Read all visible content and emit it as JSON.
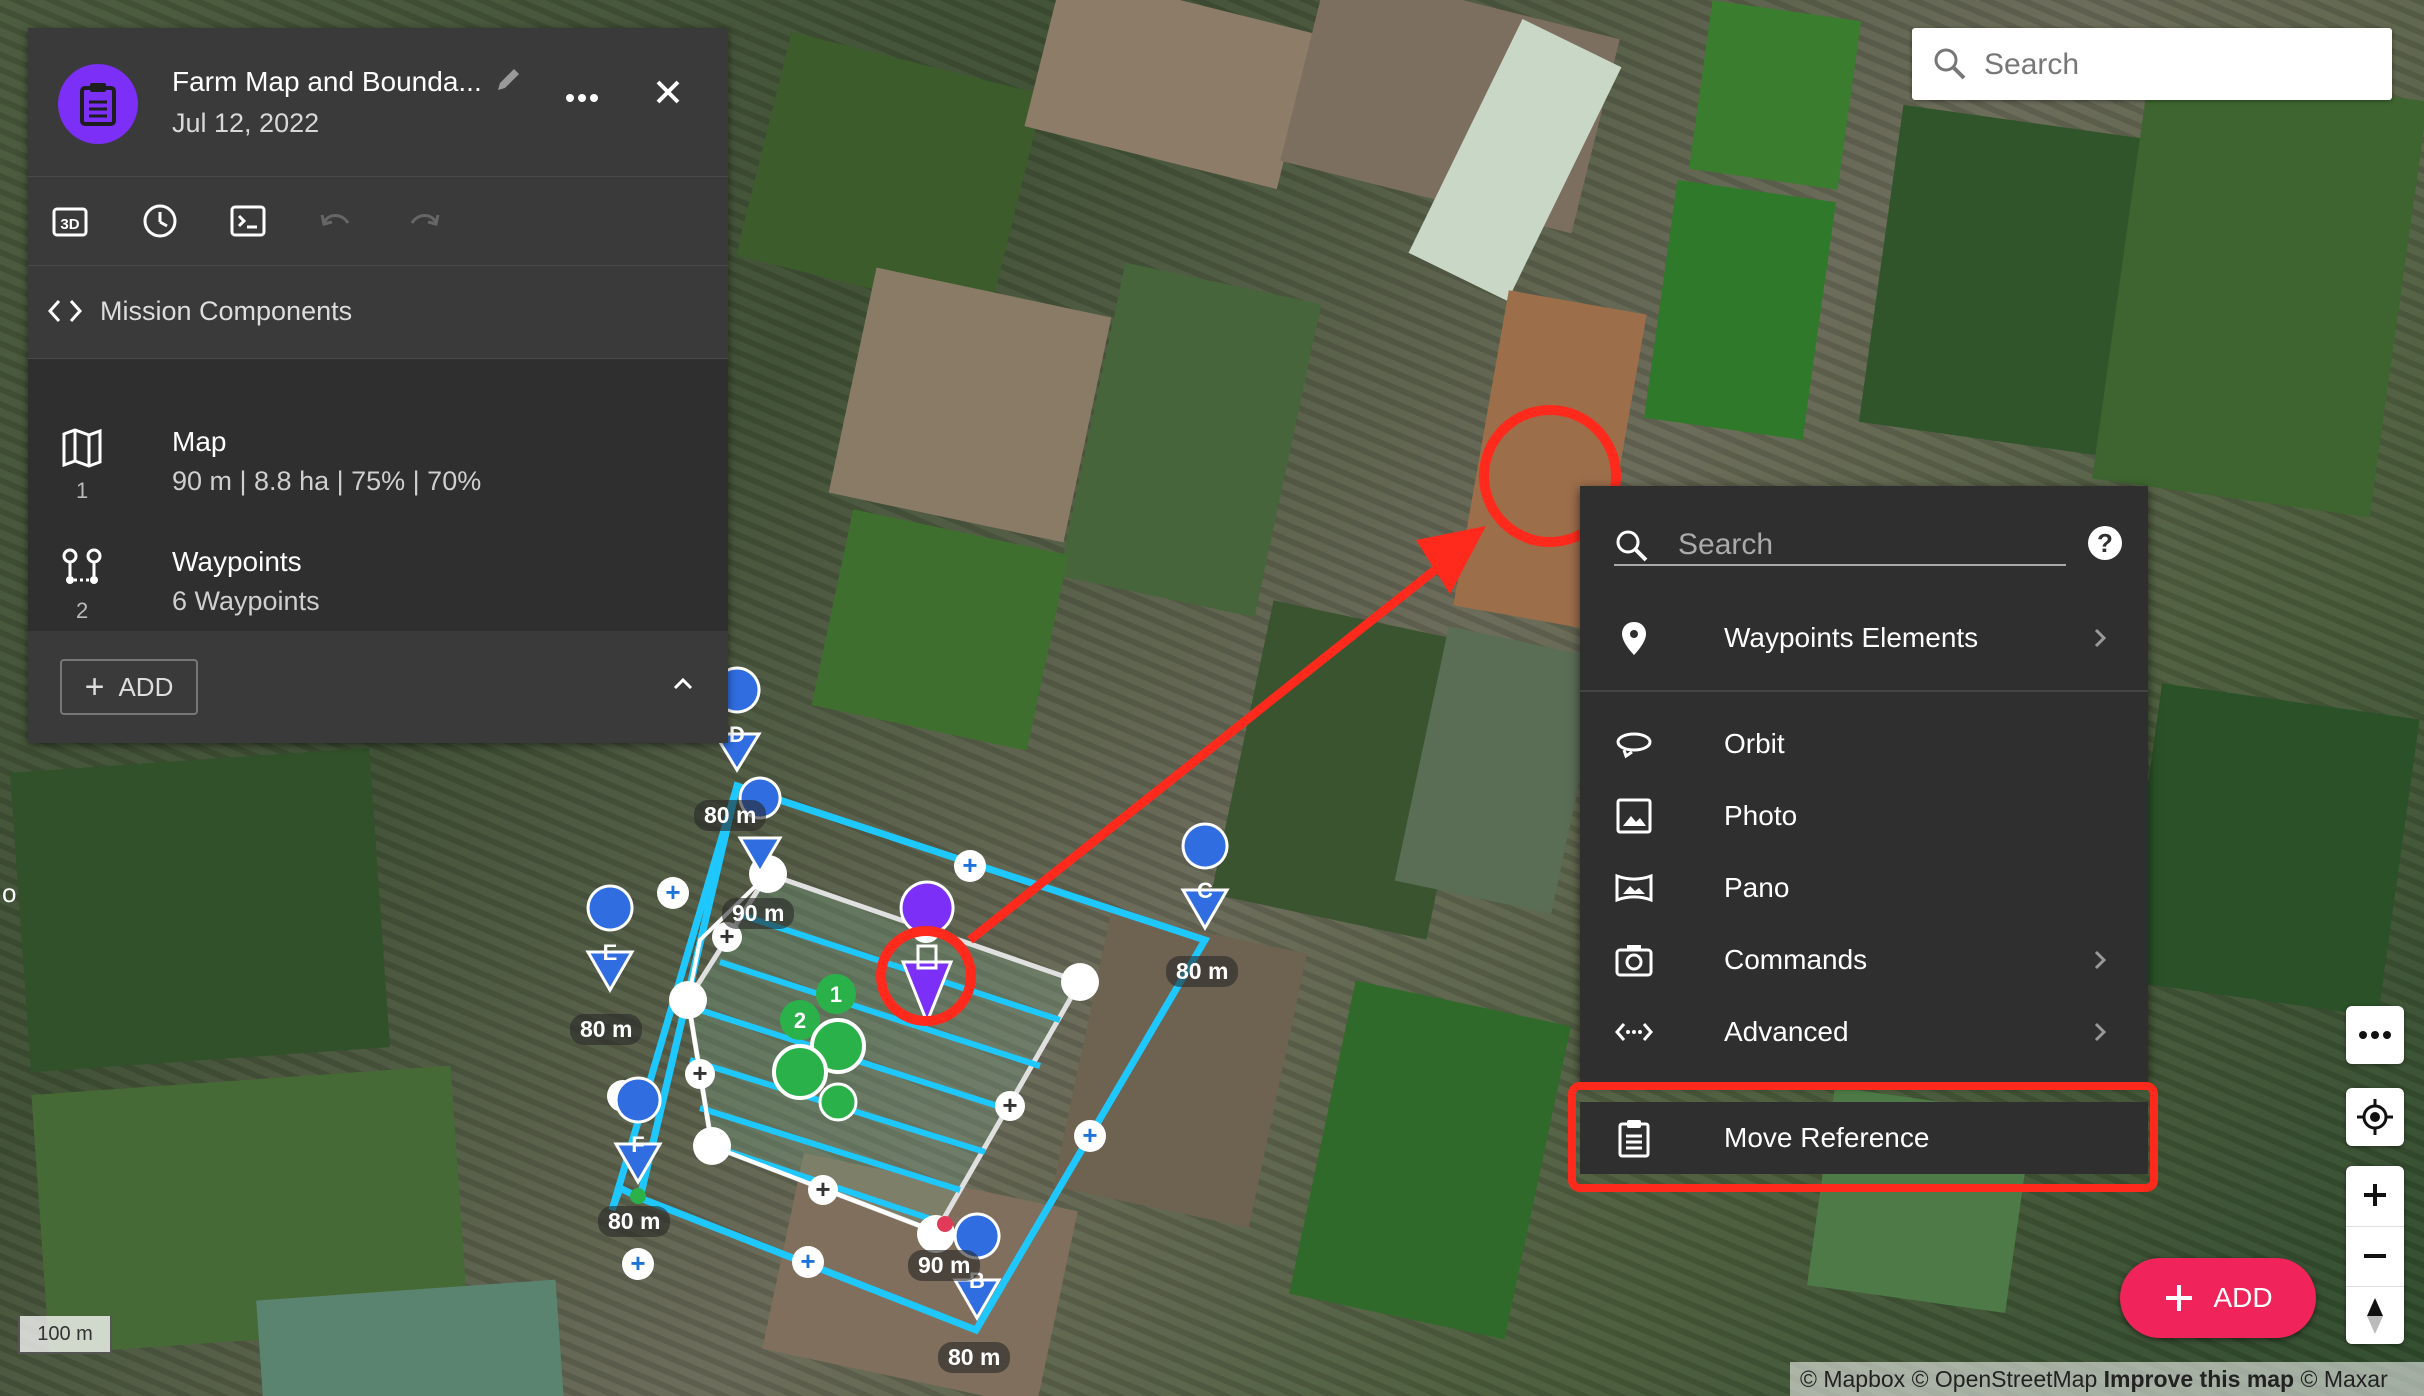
{
  "mission": {
    "title": "Farm Map and Bounda...",
    "date": "Jul 12, 2022",
    "section_label": "Mission Components",
    "components": [
      {
        "name": "Map",
        "detail": "90 m | 8.8 ha | 75% | 70%",
        "index": "1",
        "icon": "map-icon"
      },
      {
        "name": "Waypoints",
        "detail": "6 Waypoints",
        "index": "2",
        "icon": "waypoints-icon"
      }
    ],
    "add_label": "ADD"
  },
  "top_search": {
    "placeholder": "Search"
  },
  "menu": {
    "search_placeholder": "Search",
    "help": "?",
    "items": [
      {
        "label": "Waypoints Elements",
        "icon": "pin-icon",
        "submenu": true
      },
      {
        "label": "Orbit",
        "icon": "orbit-icon",
        "submenu": false
      },
      {
        "label": "Photo",
        "icon": "photo-icon",
        "submenu": false
      },
      {
        "label": "Pano",
        "icon": "pano-icon",
        "submenu": false
      },
      {
        "label": "Commands",
        "icon": "camera-icon",
        "submenu": true
      },
      {
        "label": "Advanced",
        "icon": "advanced-icon",
        "submenu": true
      },
      {
        "label": "Move Reference",
        "icon": "clipboard-icon",
        "submenu": false
      }
    ]
  },
  "fab": {
    "label": "ADD"
  },
  "scale": "100 m",
  "attribution": {
    "mapbox": "© Mapbox",
    "osm": "© OpenStreetMap",
    "improve": "Improve this map",
    "maxar": "© Maxar"
  },
  "edge_label": "o",
  "map_labels": {
    "d": "80 m",
    "e": "80 m",
    "f": "80 m",
    "c": "80 m",
    "b": "80 m",
    "inner_top": "90 m",
    "inner_bottom": "90 m"
  },
  "waypoint_letters": [
    "D",
    "E",
    "F",
    "C",
    "B"
  ],
  "waypoint_badges": [
    "1",
    "2"
  ],
  "colors": {
    "accent": "#7b2ff7",
    "fab": "#f0245a",
    "highlight": "#ff2a1c",
    "boundary": "#1ec8ff",
    "waypoint": "#2f6de1"
  }
}
